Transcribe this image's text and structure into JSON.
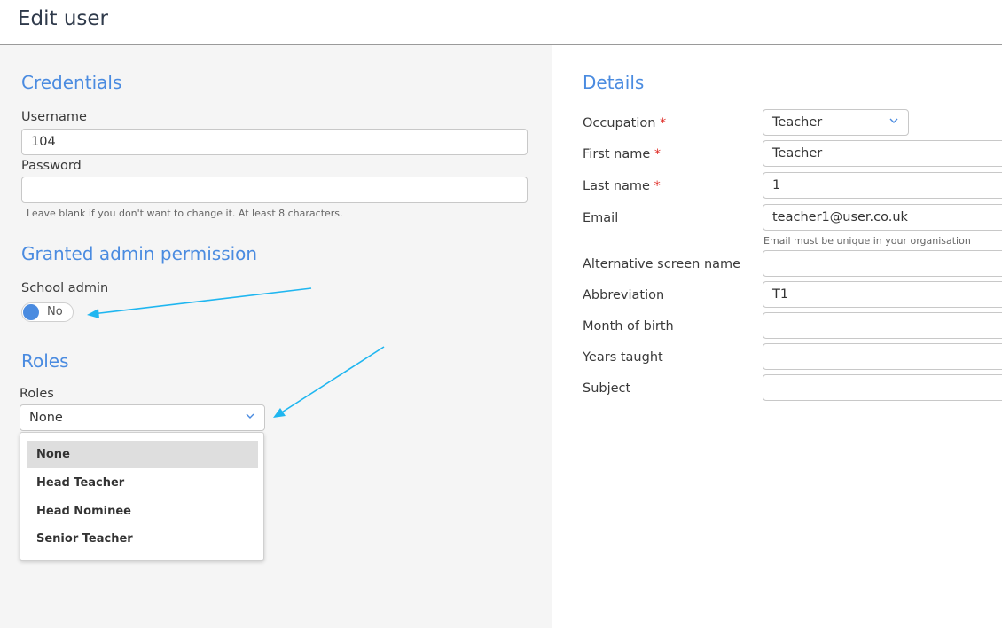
{
  "header": {
    "title": "Edit user"
  },
  "credentials": {
    "title": "Credentials",
    "username_label": "Username",
    "username_value": "104",
    "password_label": "Password",
    "password_value": "",
    "password_help": "Leave blank if you don't want to change it. At least 8 characters."
  },
  "admin": {
    "title": "Granted admin permission",
    "school_admin_label": "School admin",
    "toggle_text": "No"
  },
  "roles": {
    "title": "Roles",
    "label": "Roles",
    "selected": "None",
    "options": [
      "None",
      "Head Teacher",
      "Head Nominee",
      "Senior Teacher"
    ]
  },
  "details": {
    "title": "Details",
    "required_mark": "*",
    "occupation_label": "Occupation",
    "occupation_value": "Teacher",
    "first_name_label": "First name",
    "first_name_value": "Teacher",
    "last_name_label": "Last name",
    "last_name_value": "1",
    "email_label": "Email",
    "email_value": "teacher1@user.co.uk",
    "email_help": "Email must be unique in your organisation",
    "alt_name_label": "Alternative screen name",
    "alt_name_value": "",
    "abbreviation_label": "Abbreviation",
    "abbreviation_value": "T1",
    "month_of_birth_label": "Month of birth",
    "month_of_birth_value": "",
    "years_taught_label": "Years taught",
    "years_taught_value": "",
    "subject_label": "Subject",
    "subject_value": ""
  },
  "colors": {
    "accent": "#4a8be0",
    "annotation_arrow": "#1fb6f0",
    "required": "#e0302a"
  }
}
